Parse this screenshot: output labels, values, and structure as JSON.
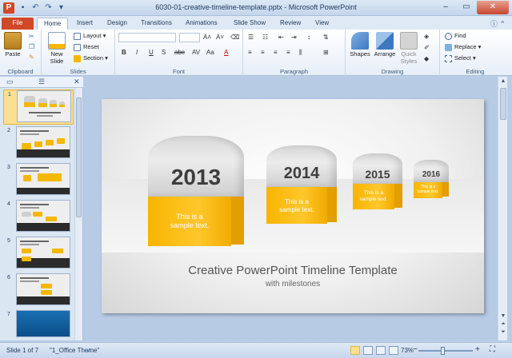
{
  "window": {
    "title": "6030-01-creative-timeline-template.pptx - Microsoft PowerPoint",
    "app_icon": "P",
    "controls": {
      "minimize": "–",
      "maximize": "▭",
      "close": "✕"
    }
  },
  "tabs": [
    "File",
    "Home",
    "Insert",
    "Design",
    "Transitions",
    "Animations",
    "Slide Show",
    "Review",
    "View"
  ],
  "ribbon": {
    "clipboard": {
      "label": "Clipboard",
      "paste": "Paste"
    },
    "slides": {
      "label": "Slides",
      "new_slide": "New Slide",
      "new_slide_line2": "Slide",
      "layout": "Layout",
      "reset": "Reset",
      "section": "Section"
    },
    "font": {
      "label": "Font"
    },
    "paragraph": {
      "label": "Paragraph"
    },
    "drawing": {
      "label": "Drawing",
      "shapes": "Shapes",
      "arrange": "Arrange",
      "quick_styles": "Quick",
      "quick_styles_line2": "Styles"
    },
    "editing": {
      "label": "Editing",
      "find": "Find",
      "replace": "Replace",
      "select": "Select"
    }
  },
  "thumbnails": [
    "1",
    "2",
    "3",
    "4",
    "5",
    "6",
    "7"
  ],
  "slide": {
    "milestones": [
      {
        "year": "2013",
        "text1": "This is a",
        "text2": "sample text."
      },
      {
        "year": "2014",
        "text1": "This is a",
        "text2": "sample text."
      },
      {
        "year": "2015",
        "text1": "This is a",
        "text2": "sample text."
      },
      {
        "year": "2016",
        "text1": "This is a",
        "text2": "sample text."
      }
    ],
    "title": "Creative PowerPoint Timeline Template",
    "subtitle": "with milestones"
  },
  "status": {
    "slide_info": "Slide 1 of 7",
    "theme": "\"1_Office Theme\"",
    "zoom": "73%"
  },
  "colors": {
    "accent_yellow": "#f7b500",
    "file_tab": "#d24726"
  }
}
